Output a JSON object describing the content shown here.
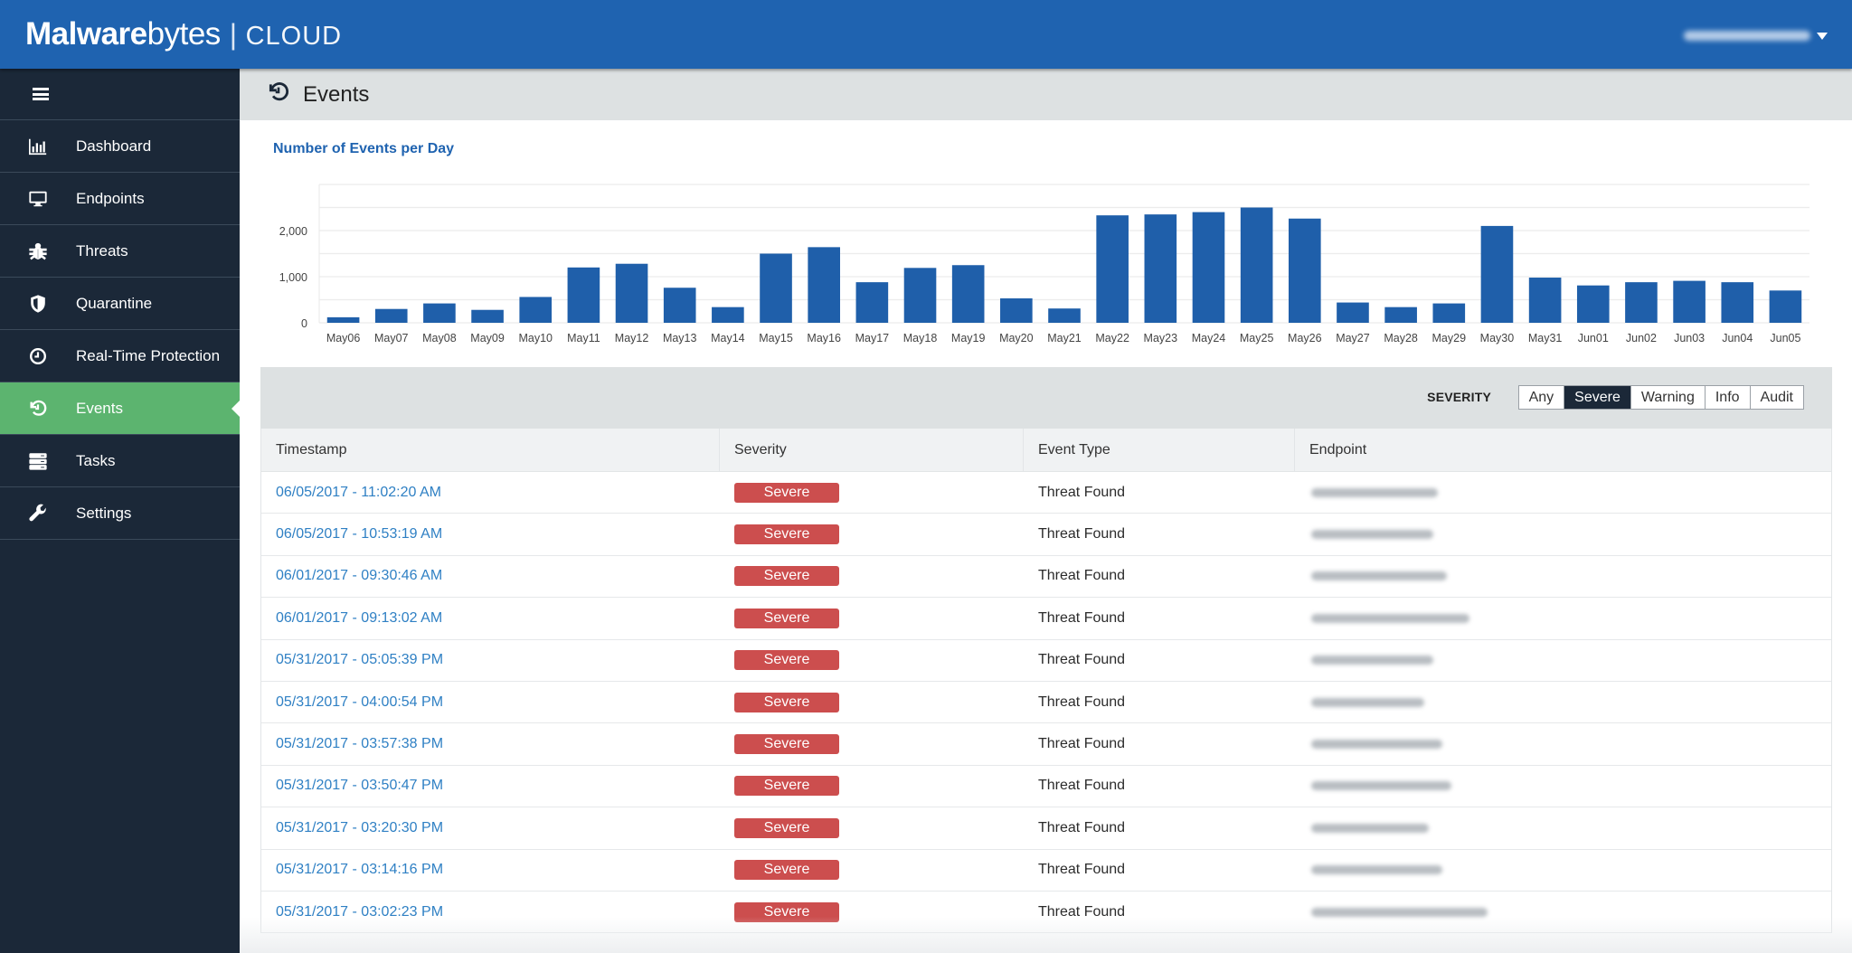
{
  "app": {
    "logo_brand_bold": "Malware",
    "logo_brand_light": "bytes",
    "logo_separator": "|",
    "logo_product": "CLOUD",
    "user_menu_icon": "caret-down-icon"
  },
  "sidebar": {
    "menu_icon": "hamburger-icon",
    "items": [
      {
        "label": "Dashboard",
        "icon": "bar-chart-icon",
        "active": false
      },
      {
        "label": "Endpoints",
        "icon": "monitor-icon",
        "active": false
      },
      {
        "label": "Threats",
        "icon": "bug-icon",
        "active": false
      },
      {
        "label": "Quarantine",
        "icon": "shield-icon",
        "active": false
      },
      {
        "label": "Real-Time Protection",
        "icon": "clock-icon",
        "active": false
      },
      {
        "label": "Events",
        "icon": "history-icon",
        "active": true
      },
      {
        "label": "Tasks",
        "icon": "tasks-icon",
        "active": false
      },
      {
        "label": "Settings",
        "icon": "wrench-icon",
        "active": false
      }
    ]
  },
  "page": {
    "title": "Events",
    "icon": "history-icon"
  },
  "chart_data": {
    "type": "bar",
    "title": "Number of Events per Day",
    "xlabel": "",
    "ylabel": "",
    "ylim": [
      0,
      3000
    ],
    "yticks": [
      0,
      1000,
      2000
    ],
    "ytick_labels": [
      "0",
      "1,000",
      "2,000"
    ],
    "grid_step": 500,
    "grid": true,
    "color": "#1f5faa",
    "categories": [
      "May06",
      "May07",
      "May08",
      "May09",
      "May10",
      "May11",
      "May12",
      "May13",
      "May14",
      "May15",
      "May16",
      "May17",
      "May18",
      "May19",
      "May20",
      "May21",
      "May22",
      "May23",
      "May24",
      "May25",
      "May26",
      "May27",
      "May28",
      "May29",
      "May30",
      "May31",
      "Jun01",
      "Jun02",
      "Jun03",
      "Jun04",
      "Jun05"
    ],
    "values": [
      120,
      300,
      420,
      280,
      560,
      1200,
      1280,
      760,
      340,
      1500,
      1640,
      880,
      1190,
      1250,
      530,
      310,
      2330,
      2350,
      2400,
      2500,
      2260,
      440,
      340,
      420,
      2100,
      980,
      810,
      880,
      910,
      880,
      700
    ]
  },
  "filter": {
    "label": "SEVERITY",
    "options": [
      "Any",
      "Severe",
      "Warning",
      "Info",
      "Audit"
    ],
    "selected": "Severe"
  },
  "table": {
    "columns": [
      "Timestamp",
      "Severity",
      "Event Type",
      "Endpoint"
    ],
    "rows": [
      {
        "timestamp": "06/05/2017 - 11:02:20 AM",
        "severity": "Severe",
        "event_type": "Threat Found"
      },
      {
        "timestamp": "06/05/2017 - 10:53:19 AM",
        "severity": "Severe",
        "event_type": "Threat Found"
      },
      {
        "timestamp": "06/01/2017 - 09:30:46 AM",
        "severity": "Severe",
        "event_type": "Threat Found"
      },
      {
        "timestamp": "06/01/2017 - 09:13:02 AM",
        "severity": "Severe",
        "event_type": "Threat Found"
      },
      {
        "timestamp": "05/31/2017 - 05:05:39 PM",
        "severity": "Severe",
        "event_type": "Threat Found"
      },
      {
        "timestamp": "05/31/2017 - 04:00:54 PM",
        "severity": "Severe",
        "event_type": "Threat Found"
      },
      {
        "timestamp": "05/31/2017 - 03:57:38 PM",
        "severity": "Severe",
        "event_type": "Threat Found"
      },
      {
        "timestamp": "05/31/2017 - 03:50:47 PM",
        "severity": "Severe",
        "event_type": "Threat Found"
      },
      {
        "timestamp": "05/31/2017 - 03:20:30 PM",
        "severity": "Severe",
        "event_type": "Threat Found"
      },
      {
        "timestamp": "05/31/2017 - 03:14:16 PM",
        "severity": "Severe",
        "event_type": "Threat Found"
      },
      {
        "timestamp": "05/31/2017 - 03:02:23 PM",
        "severity": "Severe",
        "event_type": "Threat Found"
      }
    ]
  },
  "colors": {
    "header_blue": "#1f63b0",
    "sidebar_bg": "#1b2838",
    "active_green": "#5cb46f",
    "severe_red": "#cc4e4e",
    "link_blue": "#2f80c4"
  }
}
